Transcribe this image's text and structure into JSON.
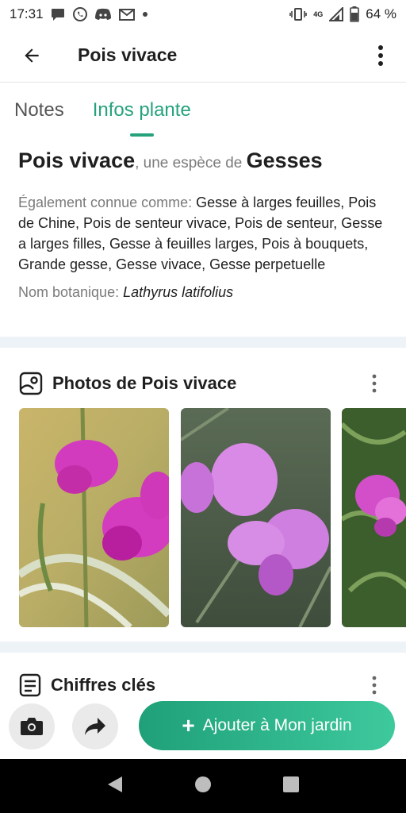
{
  "status_bar": {
    "time": "17:31",
    "network": "4G",
    "battery": "64 %"
  },
  "app_bar": {
    "title": "Pois vivace"
  },
  "tabs": [
    {
      "label": "Notes"
    },
    {
      "label": "Infos plante"
    }
  ],
  "info": {
    "plant_name": "Pois vivace",
    "species_connector": ", une espèce de ",
    "genus": "Gesses",
    "aka_label": "Également connue comme:",
    "aka_names": "Gesse à larges feuilles, Pois de Chine, Pois de senteur vivace, Pois de senteur, Gesse a larges filles, Gesse à feuilles larges, Pois à bouquets, Grande gesse, Gesse vivace, Gesse perpetuelle",
    "botanical_label": "Nom botanique:",
    "botanical_name": "Lathyrus latifolius"
  },
  "photos_section": {
    "title": "Photos de Pois vivace"
  },
  "key_figures_section": {
    "title": "Chiffres clés"
  },
  "actions": {
    "add_label": "Ajouter à Mon jardin"
  },
  "colors": {
    "accent": "#25a27c",
    "divider": "#eef3f8"
  },
  "icons": [
    "chat-icon",
    "whatsapp-icon",
    "discord-icon",
    "gmail-icon",
    "vibrate-icon",
    "signal-icon",
    "battery-icon",
    "back-arrow-icon",
    "more-vert-icon",
    "photo-icon",
    "notes-icon",
    "camera-icon",
    "share-icon",
    "plus-icon",
    "nav-back-icon",
    "nav-home-icon",
    "nav-recents-icon"
  ]
}
